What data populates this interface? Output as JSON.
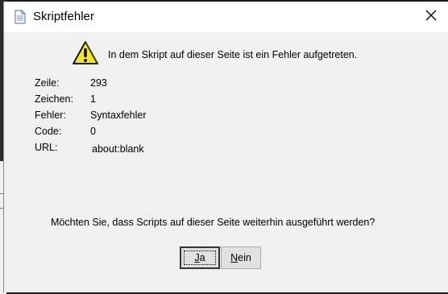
{
  "dialog": {
    "title": "Skriptfehler",
    "message": "In dem Skript auf dieser Seite ist ein Fehler aufgetreten.",
    "details": [
      {
        "label": "Zeile:",
        "value": "293"
      },
      {
        "label": "Zeichen:",
        "value": "1"
      },
      {
        "label": "Fehler:",
        "value": "Syntaxfehler"
      },
      {
        "label": "Code:",
        "value": "0"
      },
      {
        "label": "URL:",
        "value": "about:blank"
      }
    ],
    "question": "Möchten Sie, dass Scripts auf dieser Seite weiterhin ausgeführt werden?",
    "buttons": {
      "yes": {
        "mnemonic": "J",
        "rest": "a"
      },
      "no": {
        "mnemonic": "N",
        "rest": "ein"
      }
    }
  },
  "icons": {
    "title": "document-icon",
    "warning": "warning-icon",
    "close": "close-icon"
  },
  "colors": {
    "client_bg": "#f0f0f0",
    "warning_fill": "#f5e91a",
    "button_bg": "#e1e1e1"
  }
}
